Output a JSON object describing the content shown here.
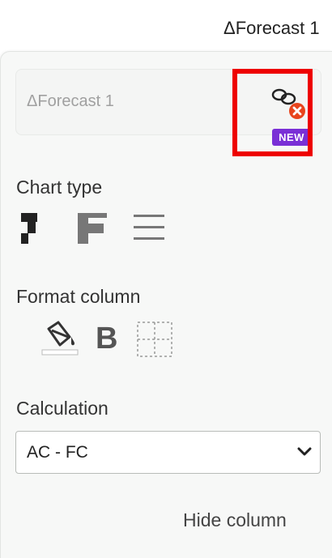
{
  "header": {
    "column_title": "ΔForecast 1"
  },
  "name_field": {
    "value": "ΔForecast 1"
  },
  "link_button": {
    "icon": "link-remove-icon",
    "badge": "NEW"
  },
  "chart_type": {
    "label": "Chart type",
    "options": [
      {
        "icon": "waterfall-bar-icon"
      },
      {
        "icon": "bar-chart-icon"
      },
      {
        "icon": "list-lines-icon"
      }
    ]
  },
  "format_column": {
    "label": "Format column",
    "options": [
      {
        "icon": "paint-bucket-icon"
      },
      {
        "icon": "bold-icon",
        "text": "B"
      },
      {
        "icon": "borders-icon"
      }
    ]
  },
  "calculation": {
    "label": "Calculation",
    "selected": "AC - FC"
  },
  "hide_column": {
    "label": "Hide column"
  },
  "colors": {
    "accent_red": "#ee0000",
    "badge_purple": "#7a2fd6",
    "remove_orange": "#e8441c"
  }
}
